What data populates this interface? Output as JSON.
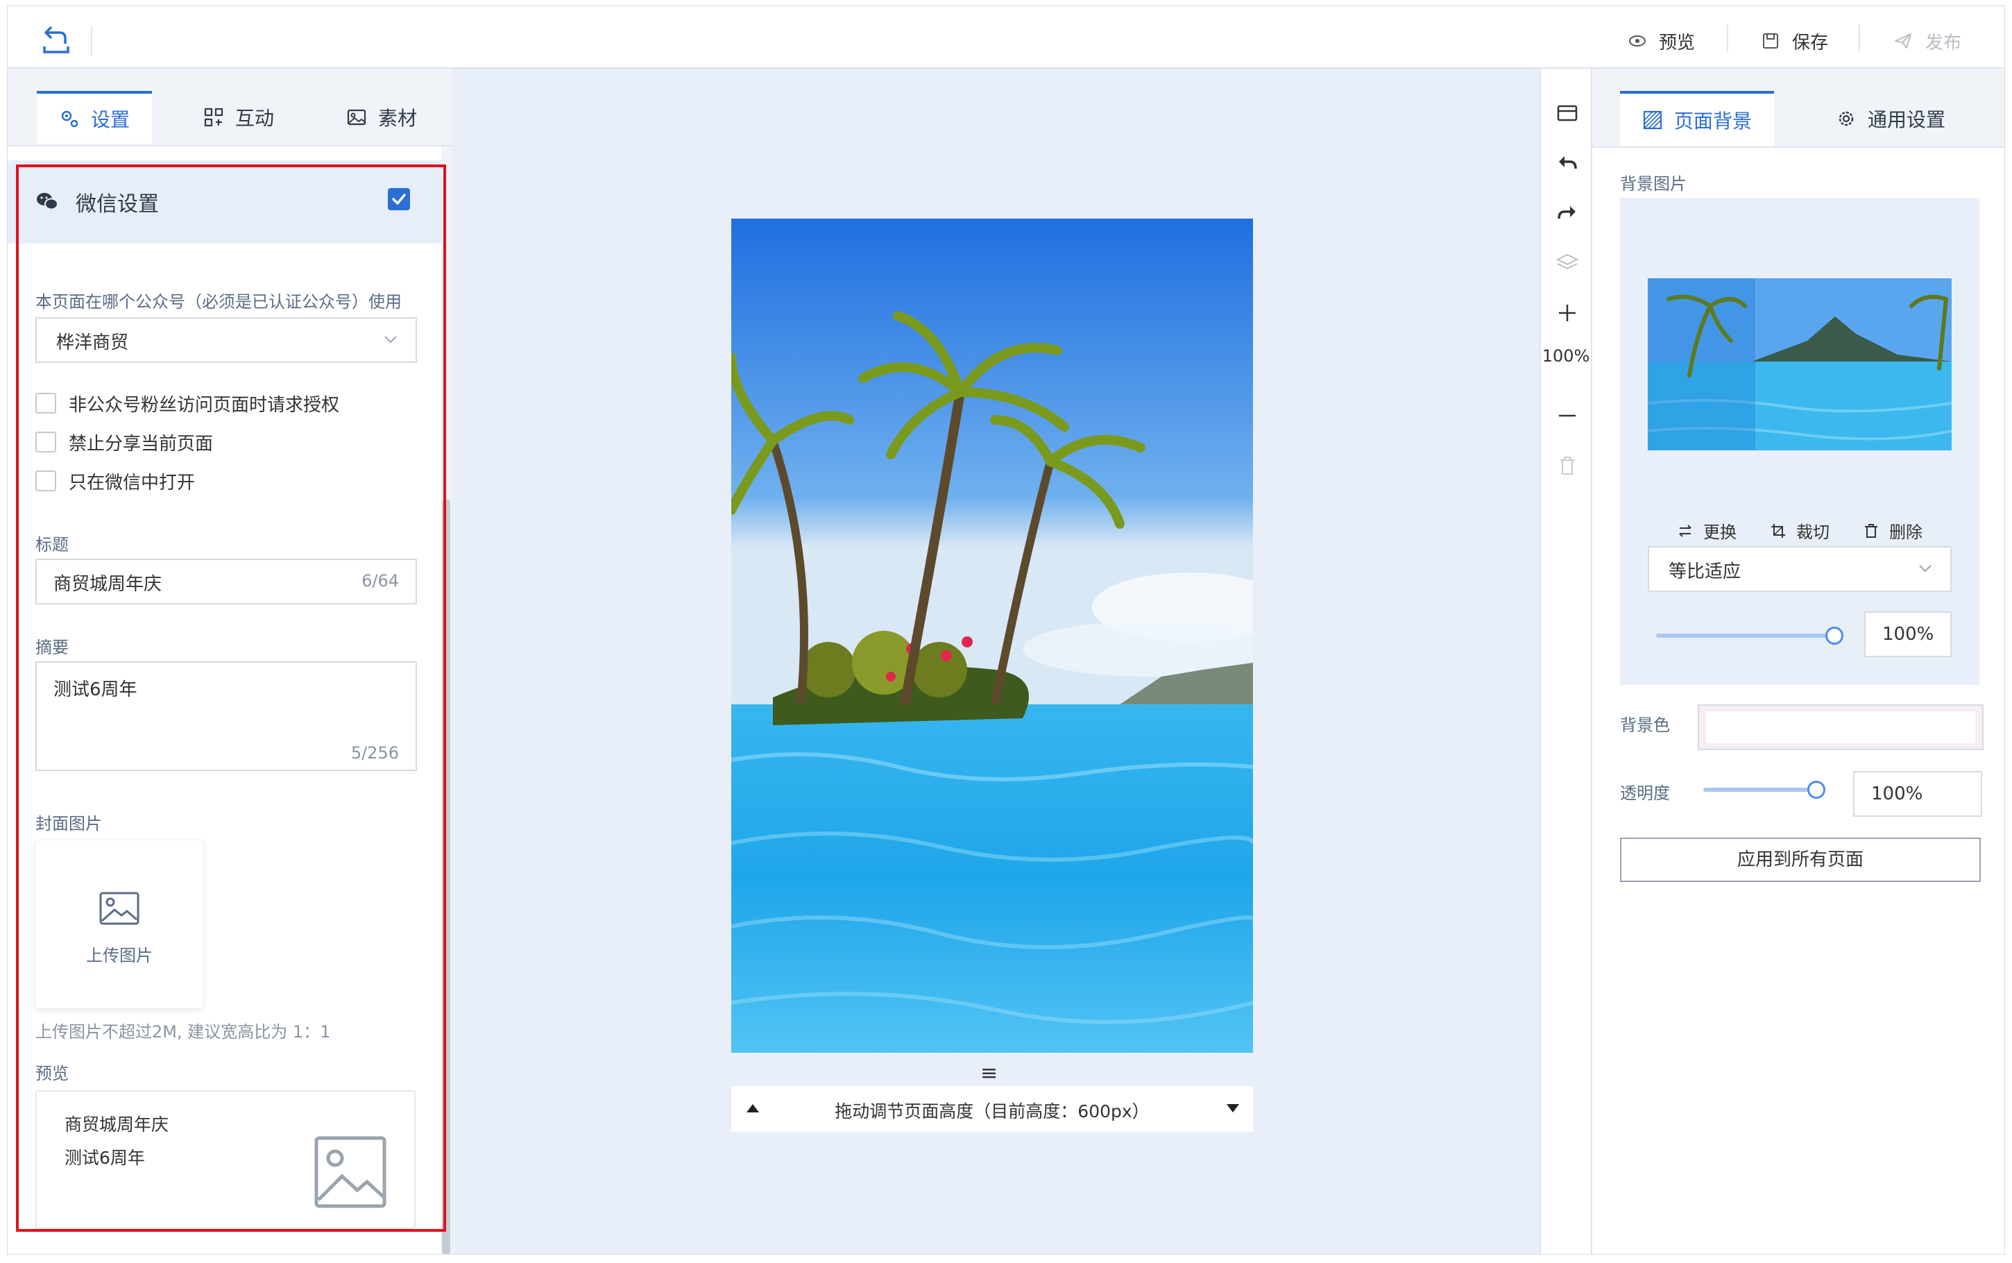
{
  "topbar": {
    "preview_label": "预览",
    "save_label": "保存",
    "publish_label": "发布"
  },
  "left_tabs": [
    {
      "label": "设置",
      "icon": "gear-icon",
      "active": true
    },
    {
      "label": "互动",
      "icon": "interact-icon",
      "active": false
    },
    {
      "label": "素材",
      "icon": "image-icon",
      "active": false
    }
  ],
  "wechat": {
    "section_title": "微信设置",
    "enabled": true,
    "account_label": "本页面在哪个公众号（必须是已认证公众号）使用",
    "account_value": "桦洋商贸",
    "checkboxes": [
      "非公众号粉丝访问页面时请求授权",
      "禁止分享当前页面",
      "只在微信中打开"
    ],
    "title_label": "标题",
    "title_value": "商贸城周年庆",
    "title_count": "6/64",
    "summary_label": "摘要",
    "summary_value": "测试6周年",
    "summary_count": "5/256",
    "cover_label": "封面图片",
    "upload_label": "上传图片",
    "upload_hint": "上传图片不超过2M, 建议宽高比为 1：1",
    "preview_label": "预览",
    "preview_title": "商贸城周年庆",
    "preview_desc": "测试6周年"
  },
  "canvas": {
    "drag_icon": "≡",
    "height_text": "拖动调节页面高度（目前高度：600px）"
  },
  "tools": {
    "zoom": "100%"
  },
  "right_tabs": [
    {
      "label": "页面背景",
      "icon": "texture-icon",
      "active": true
    },
    {
      "label": "通用设置",
      "icon": "gear-icon",
      "active": false
    }
  ],
  "background": {
    "image_label": "背景图片",
    "replace_label": "更换",
    "crop_label": "裁切",
    "delete_label": "删除",
    "fit_value": "等比适应",
    "scale_value": "100%",
    "scale_level": 1.0,
    "color_label": "背景色",
    "opacity_label": "透明度",
    "opacity_value": "100%",
    "opacity_level": 1.0,
    "apply_label": "应用到所有页面"
  },
  "colors": {
    "accent": "#2b6ed4",
    "highlight": "#e0121a"
  }
}
